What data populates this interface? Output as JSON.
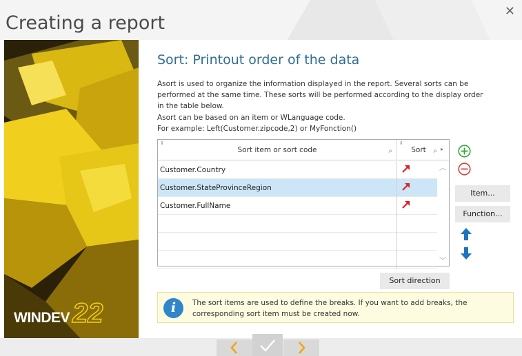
{
  "window": {
    "title": "Creating a report",
    "close_icon": "close-icon"
  },
  "branding": {
    "logo_text": "WINDEV",
    "logo_version": "22"
  },
  "step": {
    "title": "Sort: Printout order of the data",
    "description_lines": [
      "Asort is used to organize the information displayed in the report. Several sorts can be",
      "performed at the same time. These sorts will be performed according to the display order",
      "in the table below.",
      "Asort can be based on an item or WLanguage code.",
      "For example: Left(Customer.zipcode,2) or MyFonction()"
    ]
  },
  "table": {
    "columns": [
      {
        "label": "Sort item or sort code"
      },
      {
        "label": "Sort"
      }
    ],
    "rows": [
      {
        "item": "Customer.Country",
        "sort_icon": "ascending-arrow-icon",
        "selected": false
      },
      {
        "item": "Customer.StateProvinceRegion",
        "sort_icon": "ascending-arrow-icon",
        "selected": true
      },
      {
        "item": "Customer.FullName",
        "sort_icon": "ascending-arrow-icon",
        "selected": false
      }
    ]
  },
  "buttons": {
    "add_icon": "add-icon",
    "remove_icon": "remove-icon",
    "item_label": "Item...",
    "function_label": "Function...",
    "move_up_icon": "move-up-icon",
    "move_down_icon": "move-down-icon",
    "sort_direction_label": "Sort direction"
  },
  "info": {
    "icon": "info-icon",
    "lines": [
      "The sort items are used to define the breaks. If you want to add breaks, the",
      "corresponding sort item must be created now."
    ]
  },
  "footer": {
    "prev_icon": "chevron-left-icon",
    "finish_icon": "checkmark-icon",
    "next_icon": "chevron-right-icon"
  },
  "colors": {
    "accent": "#2f6d95",
    "selected_row": "#cde6f7",
    "sort_arrow": "#e02020",
    "add_green": "#3aa43a",
    "remove_red": "#e03a3a",
    "move_blue": "#1e73be",
    "info_background": "#fdfce0"
  }
}
